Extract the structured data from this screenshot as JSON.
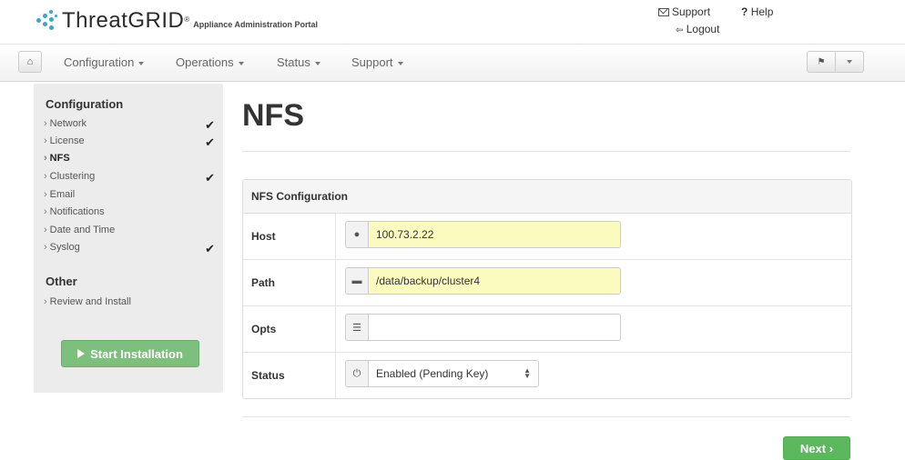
{
  "header": {
    "brand": "ThreatGRID",
    "brand_mark": "®",
    "subtitle": "Appliance Administration Portal",
    "support_label": "Support",
    "help_label": "Help",
    "help_prefix": "?",
    "logout_label": "Logout"
  },
  "navbar": {
    "items": [
      {
        "label": "Configuration"
      },
      {
        "label": "Operations"
      },
      {
        "label": "Status"
      },
      {
        "label": "Support"
      }
    ]
  },
  "sidebar": {
    "configuration_heading": "Configuration",
    "configuration_items": [
      {
        "label": "Network",
        "checked": true
      },
      {
        "label": "License",
        "checked": true
      },
      {
        "label": "NFS",
        "checked": false,
        "active": true
      },
      {
        "label": "Clustering",
        "checked": true
      },
      {
        "label": "Email",
        "checked": false
      },
      {
        "label": "Notifications",
        "checked": false
      },
      {
        "label": "Date and Time",
        "checked": false
      },
      {
        "label": "Syslog",
        "checked": true
      }
    ],
    "other_heading": "Other",
    "other_items": [
      {
        "label": "Review and Install"
      }
    ],
    "start_button_label": "Start Installation"
  },
  "main": {
    "title": "NFS",
    "panel_heading": "NFS Configuration",
    "fields": {
      "host": {
        "label": "Host",
        "value": "100.73.2.22"
      },
      "path": {
        "label": "Path",
        "value": "/data/backup/cluster4"
      },
      "opts": {
        "label": "Opts",
        "value": ""
      },
      "status": {
        "label": "Status",
        "value": "Enabled (Pending Key)"
      }
    },
    "next_label": "Next"
  },
  "colors": {
    "accent_green": "#5cb85c",
    "start_button_green": "#7dc07d",
    "filled_input_yellow": "#fbfbbf",
    "logo_blue": "#3aa7c9"
  },
  "icons": {
    "home": "home-icon",
    "flag": "flag-icon",
    "envelope": "envelope-icon",
    "logout": "logout-icon",
    "globe": "globe-icon",
    "folder": "folder-icon",
    "sliders": "sliders-icon",
    "power": "power-icon"
  }
}
